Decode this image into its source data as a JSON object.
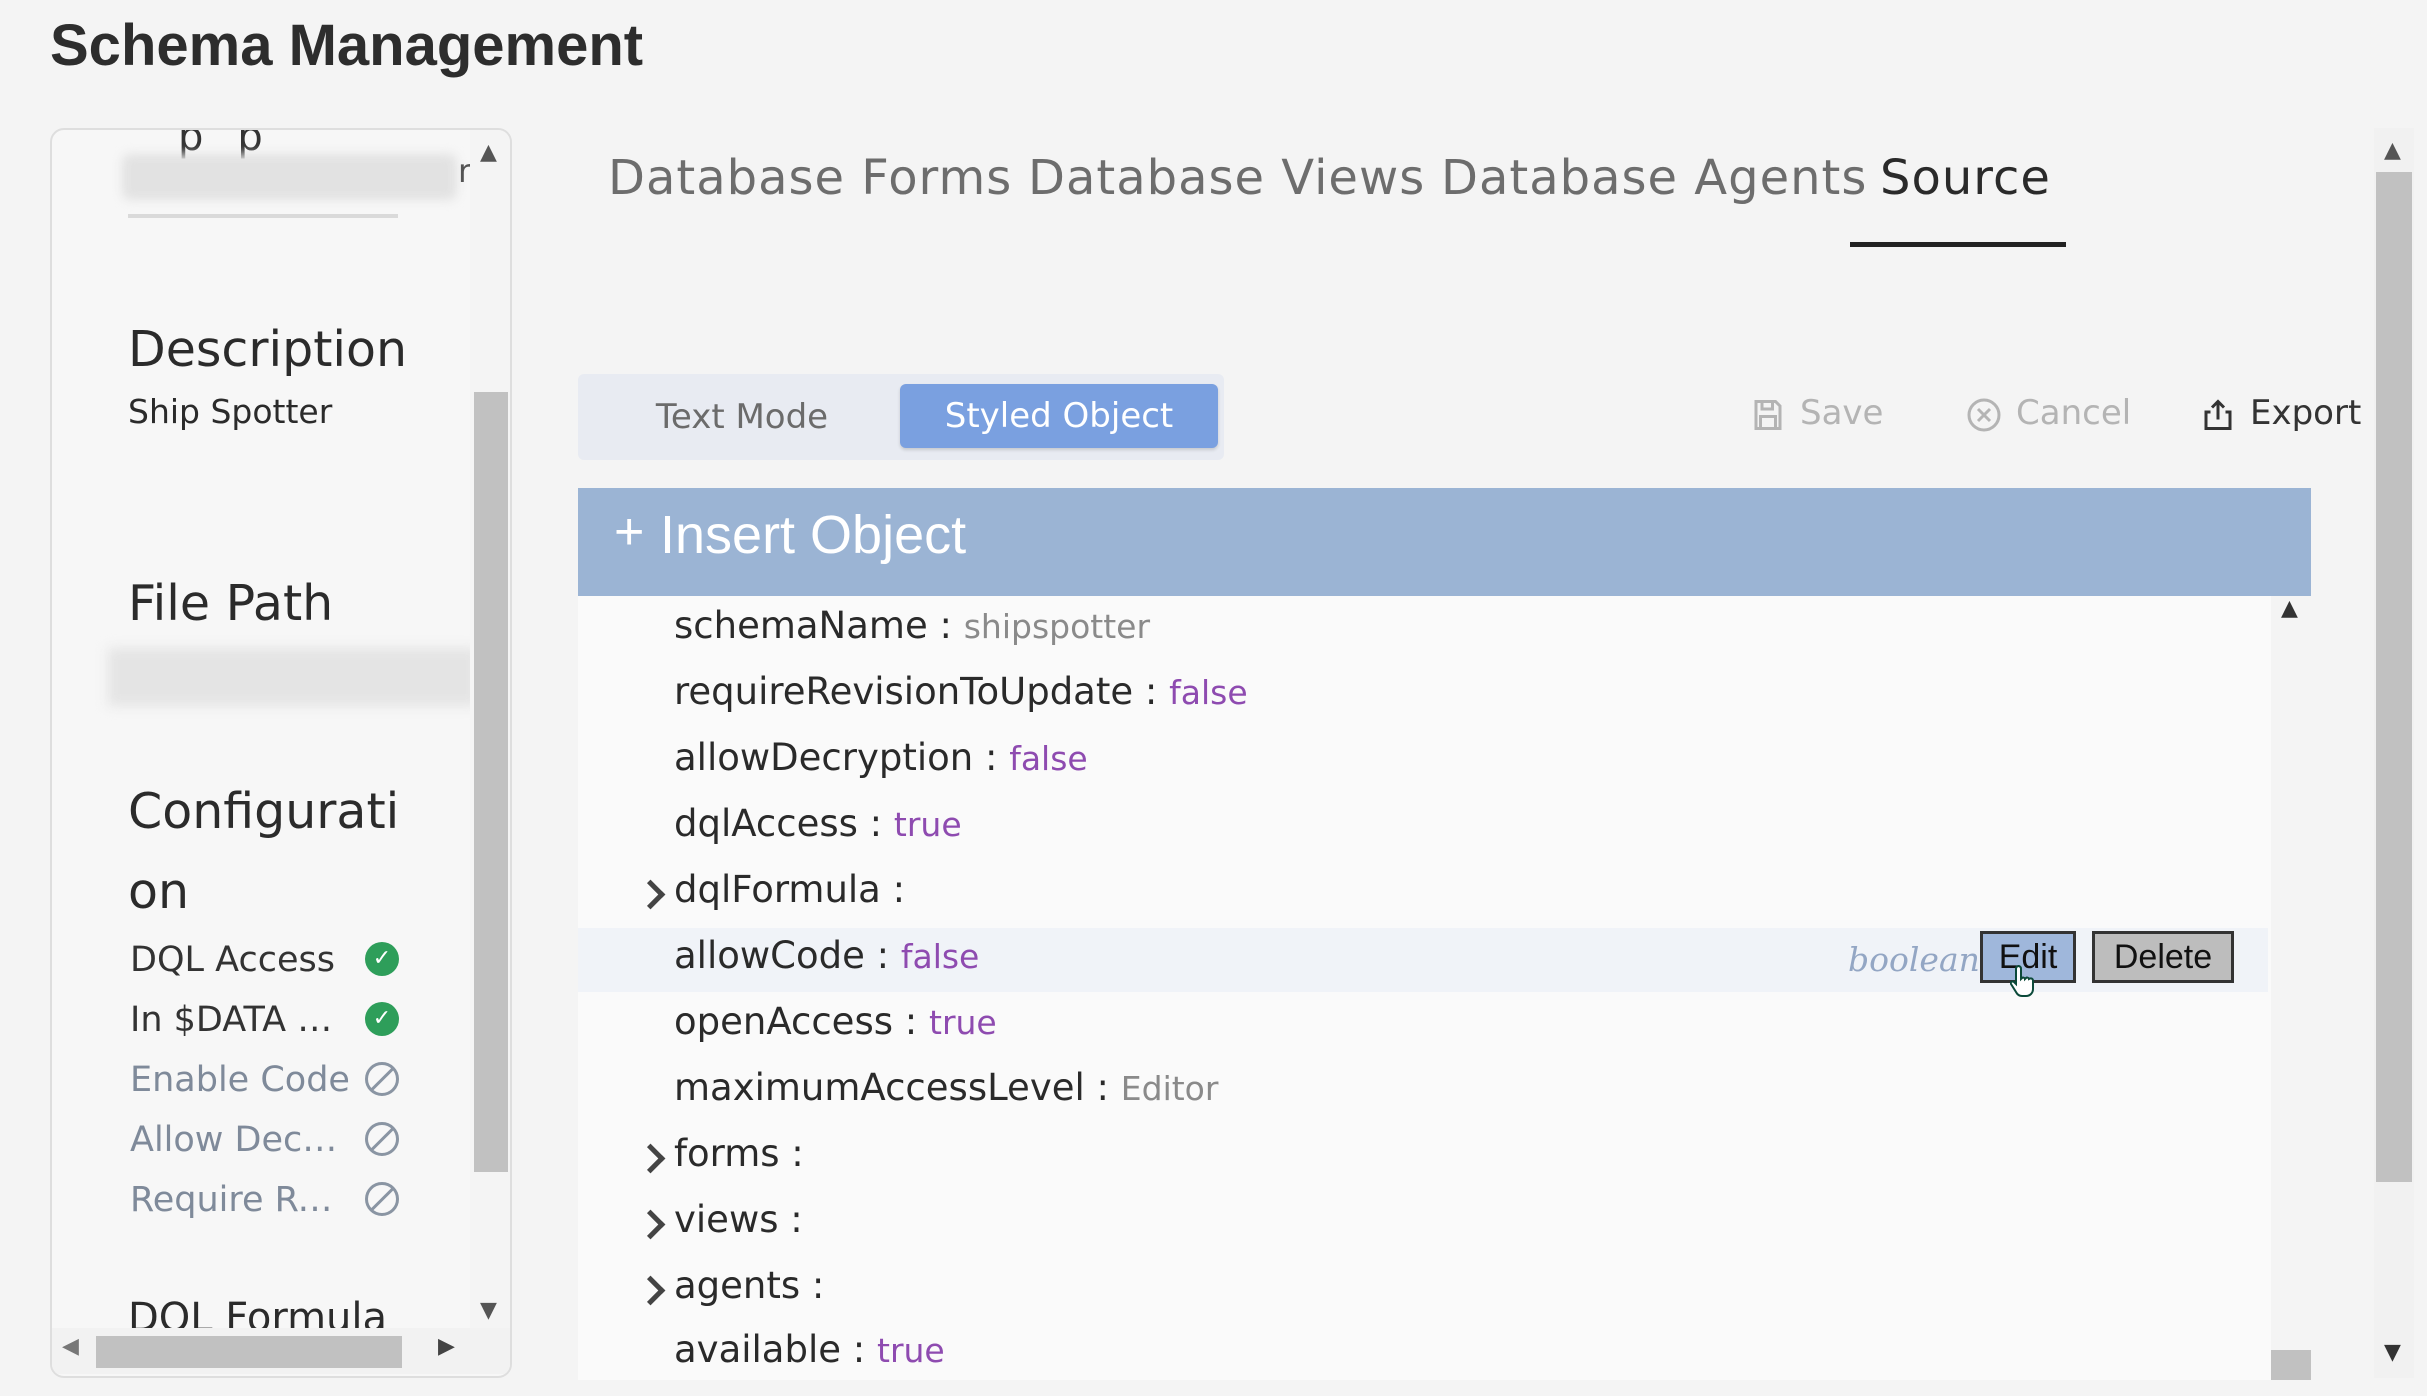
{
  "page": {
    "title": "Schema Management"
  },
  "left_panel": {
    "partial_top_text": "pp",
    "partial_char": "r",
    "description_heading": "Description",
    "description_value": "Ship Spotter",
    "file_path_heading": "File Path",
    "configuration_heading_line1": "Configurati",
    "configuration_heading_line2": "on",
    "config_items": [
      {
        "label": "DQL Access",
        "status": "enabled",
        "icon": "check-circle-icon"
      },
      {
        "label": "In $DATA S...",
        "status": "enabled",
        "icon": "check-circle-icon"
      },
      {
        "label": "Enable Code",
        "status": "disabled",
        "icon": "ban-icon"
      },
      {
        "label": "Allow Decry...",
        "status": "disabled",
        "icon": "ban-icon"
      },
      {
        "label": "Require Rev...",
        "status": "disabled",
        "icon": "ban-icon"
      }
    ],
    "dql_formula_heading": "DQL Formula"
  },
  "tabs": [
    {
      "label": "Database Forms",
      "active": false
    },
    {
      "label": "Database Views",
      "active": false
    },
    {
      "label": "Database Agents",
      "active": false
    },
    {
      "label": "Source",
      "active": true
    }
  ],
  "editor": {
    "mode_text": "Text Mode",
    "mode_styled": "Styled Object",
    "active_mode": "Styled Object",
    "save_label": "Save",
    "cancel_label": "Cancel",
    "export_label": "Export",
    "insert_label": "Insert Object",
    "insert_icon": "plus-icon"
  },
  "tree": {
    "rows": [
      {
        "key": "schemaName",
        "value": "shipspotter",
        "kind": "string",
        "expandable": false
      },
      {
        "key": "requireRevisionToUpdate",
        "value": "false",
        "kind": "boolean",
        "expandable": false
      },
      {
        "key": "allowDecryption",
        "value": "false",
        "kind": "boolean",
        "expandable": false
      },
      {
        "key": "dqlAccess",
        "value": "true",
        "kind": "boolean",
        "expandable": false
      },
      {
        "key": "dqlFormula",
        "value": "",
        "kind": "object",
        "expandable": true
      },
      {
        "key": "allowCode",
        "value": "false",
        "kind": "boolean",
        "expandable": false
      },
      {
        "key": "openAccess",
        "value": "true",
        "kind": "boolean",
        "expandable": false
      },
      {
        "key": "maximumAccessLevel",
        "value": "Editor",
        "kind": "string",
        "expandable": false
      },
      {
        "key": "forms",
        "value": "",
        "kind": "object",
        "expandable": true
      },
      {
        "key": "views",
        "value": "",
        "kind": "object",
        "expandable": true
      },
      {
        "key": "agents",
        "value": "",
        "kind": "object",
        "expandable": true
      },
      {
        "key": "available",
        "value": "true",
        "kind": "boolean",
        "expandable": false
      }
    ],
    "hover_row": {
      "type_hint": "boolean",
      "edit_label": "Edit",
      "delete_label": "Delete"
    }
  },
  "colors": {
    "accent": "#7aa0e0",
    "insert_bar": "#9bb4d4",
    "boolean_value": "#8e4bb0",
    "string_value": "#8a8a8a",
    "enabled_check": "#2e9e5a"
  }
}
